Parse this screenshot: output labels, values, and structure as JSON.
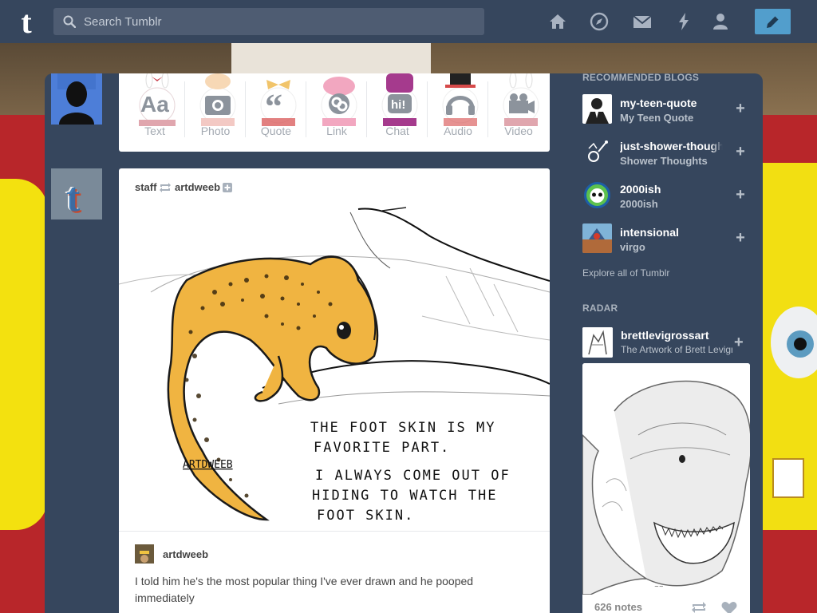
{
  "header": {
    "search_placeholder": "Search Tumblr",
    "nav": [
      "home-icon",
      "explore-icon",
      "inbox-icon",
      "activity-icon",
      "account-icon"
    ],
    "colors": {
      "header_bg": "#36465d",
      "compose_bg": "#529ecc"
    }
  },
  "post_types": [
    {
      "label": "Text",
      "icon": "text-icon"
    },
    {
      "label": "Photo",
      "icon": "camera-icon"
    },
    {
      "label": "Quote",
      "icon": "quote-icon"
    },
    {
      "label": "Link",
      "icon": "link-icon"
    },
    {
      "label": "Chat",
      "icon": "chat-icon"
    },
    {
      "label": "Audio",
      "icon": "headphones-icon"
    },
    {
      "label": "Video",
      "icon": "video-camera-icon"
    }
  ],
  "post": {
    "reblogger": "staff",
    "source": "artdweeb",
    "image_text": {
      "signature": "ARTDWEEB",
      "lines": [
        "THE FOOT SKIN IS MY",
        "FAVORITE PART.",
        "I ALWAYS COME OUT OF",
        "HIDING TO WATCH THE",
        "FOOT SKIN."
      ]
    },
    "caption_user": "artdweeb",
    "caption": "I told him he's the most popular thing I've ever drawn and he pooped immediately"
  },
  "sidebar": {
    "recommended_heading": "RECOMMENDED BLOGS",
    "recommended": [
      {
        "name": "my-teen-quote",
        "title": "My Teen Quote"
      },
      {
        "name": "just-shower-thoughts",
        "title": "Shower Thoughts"
      },
      {
        "name": "2000ish",
        "title": "2000ish"
      },
      {
        "name": "intensional",
        "title": "virgo"
      }
    ],
    "follow_symbol": "+",
    "explore_link": "Explore all of Tumblr",
    "radar_heading": "RADAR",
    "radar": {
      "name": "brettlevigrossart",
      "title": "The Artwork of Brett Levigros",
      "notes": "626 notes"
    }
  }
}
